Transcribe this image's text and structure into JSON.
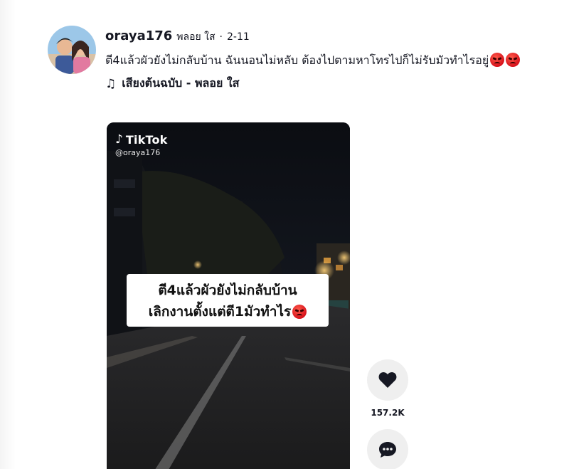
{
  "post": {
    "username": "oraya176",
    "nickname": "พลอย ใส",
    "separator": "·",
    "date": "2-11",
    "caption_text": "ตี4แล้วผัวยังไม่กลับบ้าน ฉันนอนไม่หลับ ต้องไปตามหาโทรไปก็ไม่รับมัวทำไรอยู่",
    "caption_emojis": [
      "angry-face",
      "angry-face"
    ],
    "music_label": "เสียงต้นฉบับ - พลอย ใส"
  },
  "video": {
    "watermark_brand": "TikTok",
    "watermark_handle": "@oraya176",
    "overlay_line1": "ตี4แล้วผัวยังไม่กลับบ้าน",
    "overlay_line2": "เลิกงานตั้งแต่ตี1มัวทำไร"
  },
  "actions": {
    "like_count": "157.2K"
  },
  "colors": {
    "text": "#161823",
    "button_bg": "#efefef"
  }
}
